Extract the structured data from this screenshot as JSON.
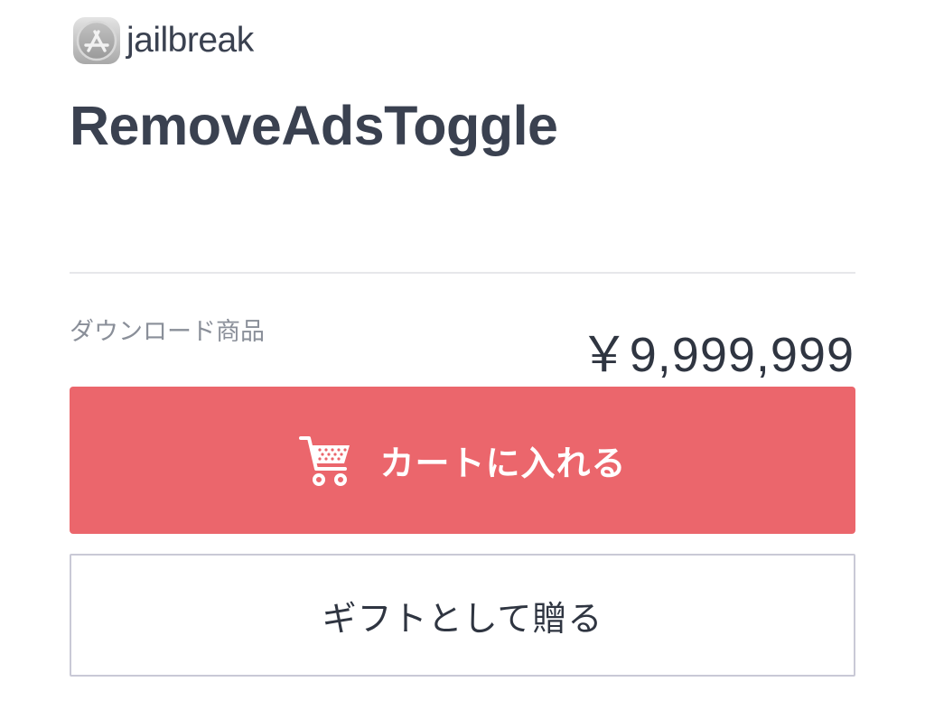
{
  "shop": {
    "icon": "app-store-icon",
    "name": "jailbreak"
  },
  "product": {
    "title": "RemoveAdsToggle",
    "category": "ダウンロード商品",
    "price": "￥9,999,999"
  },
  "actions": {
    "add_to_cart": {
      "icon": "shopping-cart-icon",
      "label": "カートに入れる"
    },
    "gift": {
      "label": "ギフトとして贈る"
    }
  },
  "colors": {
    "accent": "#eb666c",
    "text_dark": "#3a4150",
    "text_muted": "#8a8f99",
    "divider": "#e6e7ea",
    "gift_border": "#c9c9d6"
  }
}
